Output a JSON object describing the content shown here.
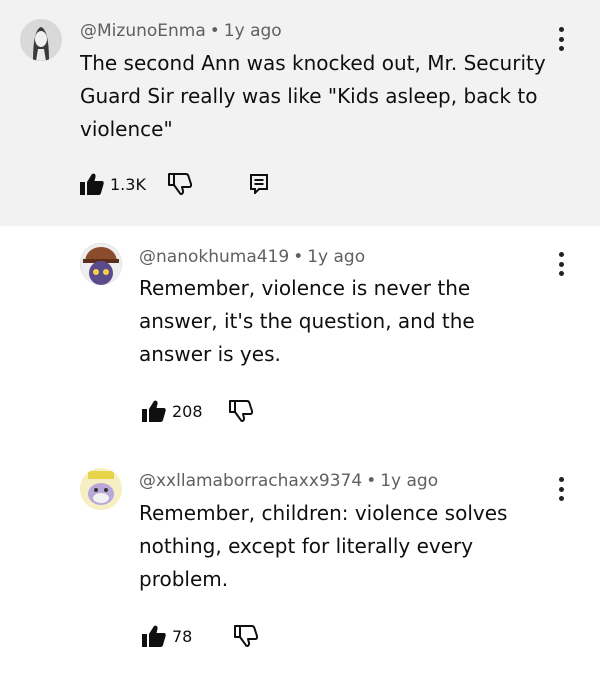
{
  "comments": [
    {
      "author": "@MizunoEnma",
      "separator": "•",
      "time": "1y ago",
      "lines": [
        "The second Ann was knocked out, Mr. Security",
        "Guard Sir really was like \"Kids asleep, back to",
        "violence\""
      ],
      "like_count": "1.3K",
      "icons": {
        "like": "thumbs-up-icon",
        "dislike": "thumbs-down-icon",
        "reply": "reply-icon",
        "more": "more-vertical-icon"
      }
    },
    {
      "author": "@nanokhuma419",
      "separator": "•",
      "time": "1y ago",
      "lines": [
        "Remember, violence is never the",
        "answer, it's the question, and the",
        "answer is yes."
      ],
      "like_count": "208",
      "icons": {
        "like": "thumbs-up-icon",
        "dislike": "thumbs-down-icon",
        "more": "more-vertical-icon"
      }
    },
    {
      "author": "@xxllamaborrachaxx9374",
      "separator": "•",
      "time": "1y ago",
      "lines": [
        "Remember, children: violence solves",
        "nothing, except for literally every",
        "problem."
      ],
      "like_count": "78",
      "icons": {
        "like": "thumbs-up-icon",
        "dislike": "thumbs-down-icon",
        "more": "more-vertical-icon"
      }
    }
  ],
  "colors": {
    "highlight_background": "#f2f2f2",
    "text": "#0f0f0f",
    "meta": "#606060"
  }
}
